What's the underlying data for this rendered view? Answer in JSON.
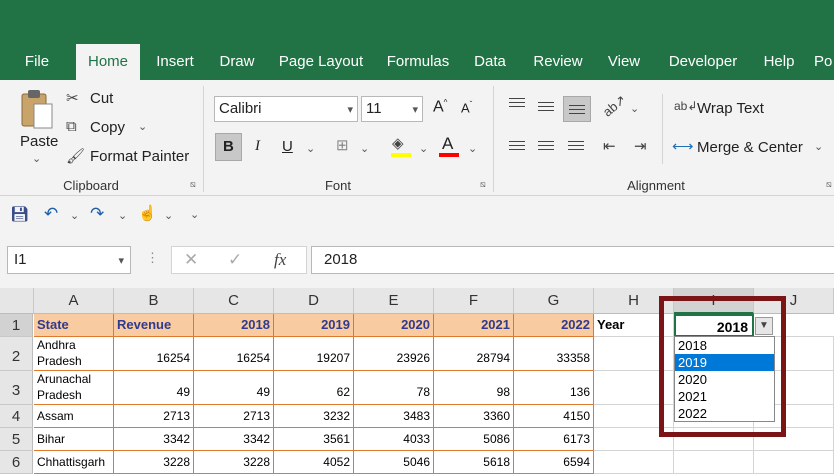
{
  "tabs": [
    "File",
    "Home",
    "Insert",
    "Draw",
    "Page Layout",
    "Formulas",
    "Data",
    "Review",
    "View",
    "Developer",
    "Help",
    "Po"
  ],
  "clipboard": {
    "paste": "Paste",
    "cut": "Cut",
    "copy": "Copy",
    "format_painter": "Format Painter",
    "label": "Clipboard"
  },
  "font": {
    "name": "Calibri",
    "size": "11",
    "grow": "A",
    "shrink": "A",
    "bold": "B",
    "italic": "I",
    "underline": "U",
    "label": "Font",
    "highlight_color": "#ffff00",
    "font_color": "#ff0000"
  },
  "alignment": {
    "wrap_text": "Wrap Text",
    "merge_center": "Merge & Center",
    "label": "Alignment"
  },
  "formula_bar": {
    "name_box": "I1",
    "fx": "fx",
    "value": "2018"
  },
  "columns": [
    "A",
    "B",
    "C",
    "D",
    "E",
    "F",
    "G",
    "H",
    "I",
    "J"
  ],
  "rows": [
    "1",
    "2",
    "3",
    "4",
    "5",
    "6"
  ],
  "header_row": [
    "State",
    "Revenue",
    "2018",
    "2019",
    "2020",
    "2021",
    "2022"
  ],
  "data_rows": [
    [
      "Andhra Pradesh",
      "16254",
      "16254",
      "19207",
      "23926",
      "28794",
      "33358"
    ],
    [
      "Arunachal Pradesh",
      "49",
      "49",
      "62",
      "78",
      "98",
      "136"
    ],
    [
      "Assam",
      "2713",
      "2713",
      "3232",
      "3483",
      "3360",
      "4150"
    ],
    [
      "Bihar",
      "3342",
      "3342",
      "3561",
      "4033",
      "5086",
      "6173"
    ],
    [
      "Chhattisgarh",
      "3228",
      "3228",
      "4052",
      "5046",
      "5618",
      "6594"
    ]
  ],
  "year_label": "Year",
  "year_value": "2018",
  "dropdown": {
    "options": [
      "2018",
      "2019",
      "2020",
      "2021",
      "2022"
    ],
    "highlighted": "2019"
  },
  "colors": {
    "excel_green": "#217346",
    "header_fill": "#f8cba0",
    "header_text": "#2f3b8f",
    "table_border": "#e07a2a",
    "highlight_box": "#7b1416",
    "selection_blue": "#0078d7"
  }
}
